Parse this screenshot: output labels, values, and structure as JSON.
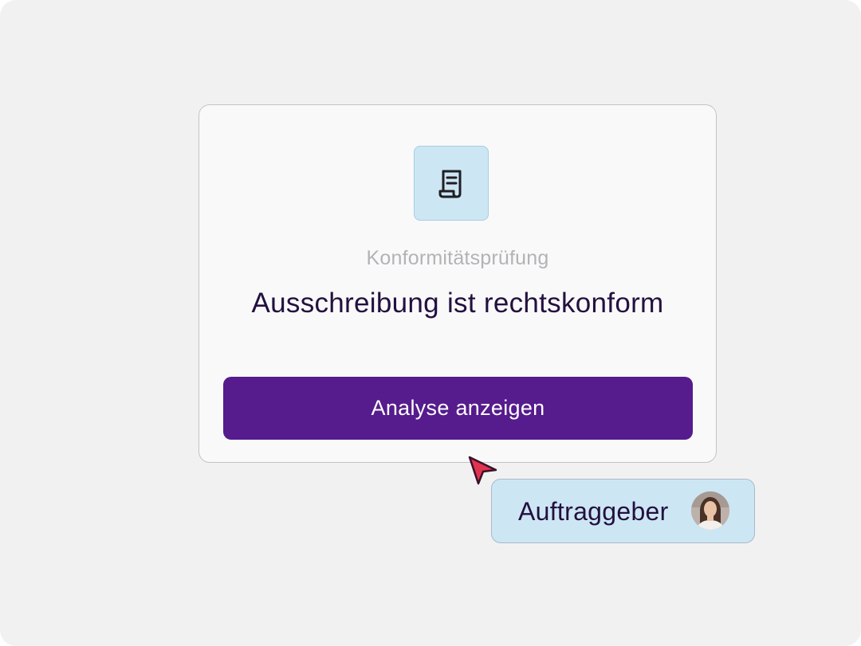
{
  "card": {
    "icon": "document-scroll-icon",
    "subtitle": "Konformitätsprüfung",
    "headline": "Ausschreibung ist rechtskonform",
    "button_label": "Analyse anzeigen"
  },
  "user_tag": {
    "label": "Auftraggeber",
    "avatar": "user-avatar"
  },
  "colors": {
    "background": "#f2f1f2",
    "card": "#f9f9f9",
    "accent": "#561b8c",
    "tile": "#cde6f4",
    "heading": "#23103f",
    "muted": "#b4b2b6",
    "cursor": "#e0334f"
  }
}
